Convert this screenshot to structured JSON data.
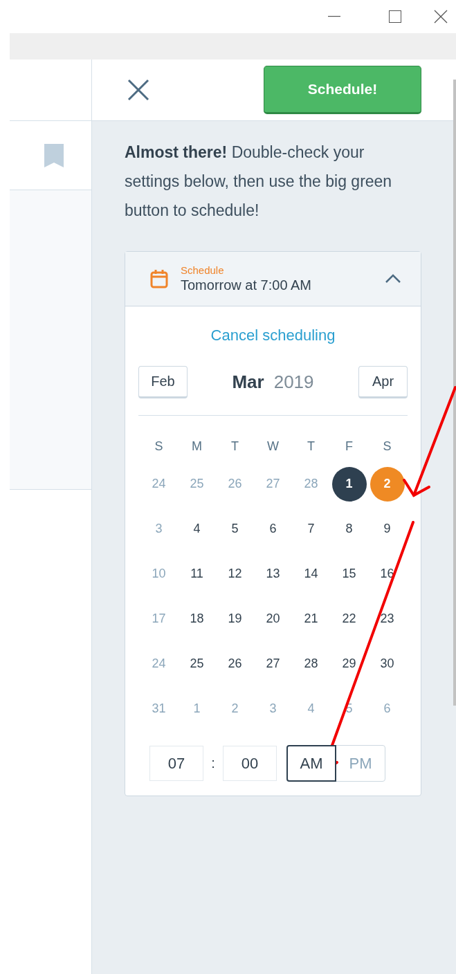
{
  "panel": {
    "schedule_button": "Schedule!",
    "intro": "**Almost there!** Double-check your settings below, then use the big green button to schedule!"
  },
  "schedule_card": {
    "label": "Schedule",
    "summary": "Tomorrow at 7:00 AM",
    "expanded": true,
    "cancel_link": "Cancel scheduling",
    "prev_month": "Feb",
    "month": "Mar",
    "year": "2019",
    "next_month": "Apr",
    "weekdays": [
      "S",
      "M",
      "T",
      "W",
      "T",
      "F",
      "S"
    ],
    "weeks": [
      [
        {
          "day": "24",
          "muted": true,
          "today": false,
          "selected": false
        },
        {
          "day": "25",
          "muted": true,
          "today": false,
          "selected": false
        },
        {
          "day": "26",
          "muted": true,
          "today": false,
          "selected": false
        },
        {
          "day": "27",
          "muted": true,
          "today": false,
          "selected": false
        },
        {
          "day": "28",
          "muted": true,
          "today": false,
          "selected": false
        },
        {
          "day": "1",
          "muted": false,
          "today": true,
          "selected": false
        },
        {
          "day": "2",
          "muted": false,
          "today": false,
          "selected": true
        }
      ],
      [
        {
          "day": "3",
          "muted": true,
          "today": false,
          "selected": false
        },
        {
          "day": "4",
          "muted": false,
          "today": false,
          "selected": false
        },
        {
          "day": "5",
          "muted": false,
          "today": false,
          "selected": false
        },
        {
          "day": "6",
          "muted": false,
          "today": false,
          "selected": false
        },
        {
          "day": "7",
          "muted": false,
          "today": false,
          "selected": false
        },
        {
          "day": "8",
          "muted": false,
          "today": false,
          "selected": false
        },
        {
          "day": "9",
          "muted": false,
          "today": false,
          "selected": false
        }
      ],
      [
        {
          "day": "10",
          "muted": true,
          "today": false,
          "selected": false
        },
        {
          "day": "11",
          "muted": false,
          "today": false,
          "selected": false
        },
        {
          "day": "12",
          "muted": false,
          "today": false,
          "selected": false
        },
        {
          "day": "13",
          "muted": false,
          "today": false,
          "selected": false
        },
        {
          "day": "14",
          "muted": false,
          "today": false,
          "selected": false
        },
        {
          "day": "15",
          "muted": false,
          "today": false,
          "selected": false
        },
        {
          "day": "16",
          "muted": false,
          "today": false,
          "selected": false
        }
      ],
      [
        {
          "day": "17",
          "muted": true,
          "today": false,
          "selected": false
        },
        {
          "day": "18",
          "muted": false,
          "today": false,
          "selected": false
        },
        {
          "day": "19",
          "muted": false,
          "today": false,
          "selected": false
        },
        {
          "day": "20",
          "muted": false,
          "today": false,
          "selected": false
        },
        {
          "day": "21",
          "muted": false,
          "today": false,
          "selected": false
        },
        {
          "day": "22",
          "muted": false,
          "today": false,
          "selected": false
        },
        {
          "day": "23",
          "muted": false,
          "today": false,
          "selected": false
        }
      ],
      [
        {
          "day": "24",
          "muted": true,
          "today": false,
          "selected": false
        },
        {
          "day": "25",
          "muted": false,
          "today": false,
          "selected": false
        },
        {
          "day": "26",
          "muted": false,
          "today": false,
          "selected": false
        },
        {
          "day": "27",
          "muted": false,
          "today": false,
          "selected": false
        },
        {
          "day": "28",
          "muted": false,
          "today": false,
          "selected": false
        },
        {
          "day": "29",
          "muted": false,
          "today": false,
          "selected": false
        },
        {
          "day": "30",
          "muted": false,
          "today": false,
          "selected": false
        }
      ],
      [
        {
          "day": "31",
          "muted": true,
          "today": false,
          "selected": false
        },
        {
          "day": "1",
          "muted": true,
          "today": false,
          "selected": false
        },
        {
          "day": "2",
          "muted": true,
          "today": false,
          "selected": false
        },
        {
          "day": "3",
          "muted": true,
          "today": false,
          "selected": false
        },
        {
          "day": "4",
          "muted": true,
          "today": false,
          "selected": false
        },
        {
          "day": "5",
          "muted": true,
          "today": false,
          "selected": false
        },
        {
          "day": "6",
          "muted": true,
          "today": false,
          "selected": false
        }
      ]
    ],
    "hour": "07",
    "separator": ":",
    "minute": "00",
    "meridiem": [
      {
        "label": "AM",
        "selected": true
      },
      {
        "label": "PM",
        "selected": false
      }
    ]
  }
}
